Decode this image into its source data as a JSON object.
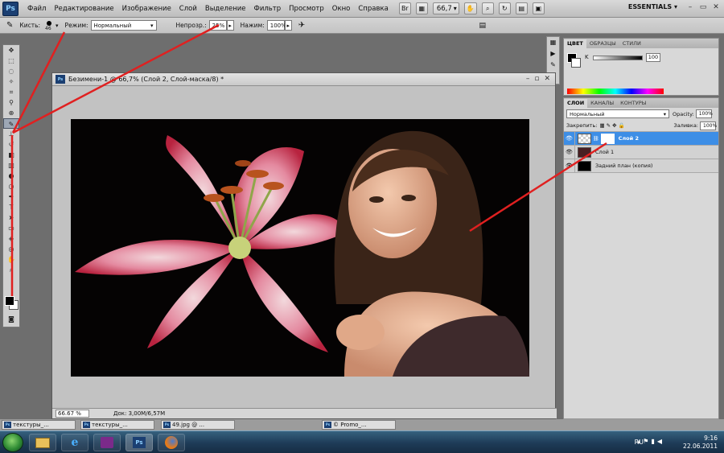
{
  "menubar": {
    "logo": "Ps",
    "items": [
      "Файл",
      "Редактирование",
      "Изображение",
      "Слой",
      "Выделение",
      "Фильтр",
      "Просмотр",
      "Окно",
      "Справка"
    ],
    "bridge": "Br",
    "zoom": "66,7",
    "workspace": "ESSENTIALS"
  },
  "options": {
    "brush_label": "Кисть:",
    "brush_size": "46",
    "mode_label": "Режим:",
    "mode_value": "Нормальный",
    "opacity_label": "Непрозр.:",
    "opacity_value": "25%",
    "flow_label": "Нажим:",
    "flow_value": "100%"
  },
  "document": {
    "title": "Безимени-1 @ 66,7% (Слой 2, Слой-маска/8) *",
    "zoom_field": "66.67 %",
    "doc_info": "Док: 3,00M/6,57M"
  },
  "color_panel": {
    "tabs": [
      "ЦВЕТ",
      "ОБРАЗЦЫ",
      "СТИЛИ"
    ],
    "channel_label": "K",
    "channel_value": "100"
  },
  "layers_panel": {
    "tabs": [
      "СЛОИ",
      "КАНАЛЫ",
      "КОНТУРЫ"
    ],
    "blend_mode": "Нормальный",
    "opacity_label": "Opacity:",
    "opacity_value": "100%",
    "lock_label": "Закрепить:",
    "fill_label": "Заливка:",
    "fill_value": "100%",
    "layers": [
      {
        "name": "Слой 2"
      },
      {
        "name": "Слой 1"
      },
      {
        "name": "Задний план (копия)"
      }
    ]
  },
  "doc_tabs": [
    {
      "label": "текстуры_..."
    },
    {
      "label": "текстуры_..."
    },
    {
      "label": "49.jpg @ ..."
    },
    {
      "label": "© Promo_..."
    }
  ],
  "taskbar": {
    "lang": "RU",
    "time": "9:16",
    "date": "22.06.2011"
  },
  "colors": {
    "annotation": "#e02020",
    "selected_layer": "#3d8ee6"
  }
}
